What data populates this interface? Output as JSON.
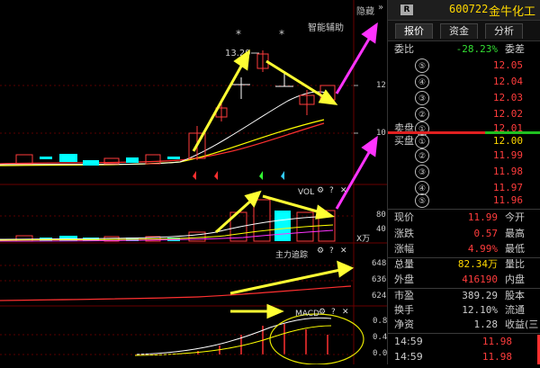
{
  "toolbar": {
    "hide_label": "隐藏",
    "smart_assist": "智能辅助",
    "vol_label": "VOL",
    "main_force_label": "主力追踪",
    "macd_label": "MACD",
    "vol_unit": "X万",
    "high_label": "13.29"
  },
  "y_ticks": {
    "price": [
      "12",
      "10"
    ],
    "vol": [
      "80",
      "40"
    ],
    "main": [
      "648",
      "636",
      "624"
    ],
    "macd": [
      "0.8",
      "0.4",
      "0.0"
    ]
  },
  "stock": {
    "badge": "R",
    "code": "600722",
    "name": "金牛化工"
  },
  "tabs": [
    "报价",
    "资金",
    "分析"
  ],
  "weibi": {
    "label": "委比",
    "value": "-28.23%",
    "right": "委差"
  },
  "sell": [
    {
      "n": "⑤",
      "price": "12.05"
    },
    {
      "n": "④",
      "price": "12.04"
    },
    {
      "n": "③",
      "price": "12.03"
    },
    {
      "n": "②",
      "price": "12.02"
    },
    {
      "label": "卖盘",
      "n": "①",
      "price": "12.01"
    }
  ],
  "buy": [
    {
      "label": "买盘",
      "n": "①",
      "price": "12.00"
    },
    {
      "n": "②",
      "price": "11.99"
    },
    {
      "n": "③",
      "price": "11.98"
    },
    {
      "n": "④",
      "price": "11.97"
    },
    {
      "n": "⑤",
      "price": "11.96"
    }
  ],
  "stats": [
    {
      "label": "现价",
      "value": "11.99",
      "right": "今开",
      "color": "red"
    },
    {
      "label": "涨跌",
      "value": "0.57",
      "right": "最高",
      "color": "red"
    },
    {
      "label": "涨幅",
      "value": "4.99%",
      "right": "最低",
      "color": "red"
    },
    {
      "label": "总量",
      "value": "82.34万",
      "right": "量比",
      "color": "yel"
    },
    {
      "label": "外盘",
      "value": "416190",
      "right": "内盘",
      "color": "red"
    }
  ],
  "fund": [
    {
      "label": "市盈",
      "value": "389.29",
      "right": "股本"
    },
    {
      "label": "换手",
      "value": "12.10%",
      "right": "流通"
    },
    {
      "label": "净资",
      "value": "1.28",
      "right": "收益(三"
    }
  ],
  "ticks": [
    {
      "time": "14:59",
      "price": "11.98"
    },
    {
      "time": "14:59",
      "price": "11.98"
    }
  ],
  "colors": {
    "up": "#ff3c3c",
    "down": "#00ffff",
    "ma5": "#ffffff",
    "ma10": "#ffff00",
    "ma20": "#ff4040",
    "accent_arrow": "#ffff33",
    "magenta": "#ff33ff"
  }
}
